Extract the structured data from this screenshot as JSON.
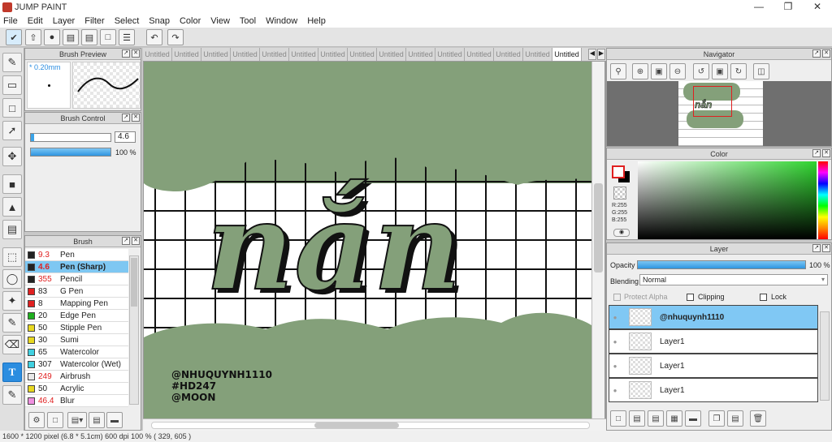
{
  "app": {
    "title": "JUMP PAINT"
  },
  "menu": [
    "File",
    "Edit",
    "Layer",
    "Filter",
    "Select",
    "Snap",
    "Color",
    "View",
    "Tool",
    "Window",
    "Help"
  ],
  "tabs": [
    "Untitled",
    "Untitled",
    "Untitled",
    "Untitled",
    "Untitled",
    "Untitled",
    "Untitled",
    "Untitled",
    "Untitled",
    "Untitled",
    "Untitled",
    "Untitled",
    "Untitled",
    "Untitled",
    "Untitled"
  ],
  "brush_preview": {
    "title": "Brush Preview",
    "size_label": "* 0.20mm"
  },
  "brush_control": {
    "title": "Brush Control",
    "size_value": "4.6",
    "opacity_value": "100 %",
    "size_fraction": 0.03,
    "opacity_fraction": 1.0
  },
  "brush": {
    "title": "Brush",
    "items": [
      {
        "size": "9.3",
        "name": "Pen",
        "color": "#222222",
        "size_red": true
      },
      {
        "size": "4.6",
        "name": "Pen (Sharp)",
        "color": "#222222",
        "size_red": true,
        "selected": true
      },
      {
        "size": "355",
        "name": "Pencil",
        "color": "#222222",
        "size_red": true
      },
      {
        "size": "83",
        "name": "G Pen",
        "color": "#e02020",
        "size_red": false
      },
      {
        "size": "8",
        "name": "Mapping Pen",
        "color": "#e02020",
        "size_red": false
      },
      {
        "size": "20",
        "name": "Edge Pen",
        "color": "#20b020",
        "size_red": false
      },
      {
        "size": "50",
        "name": "Stipple Pen",
        "color": "#e8d820",
        "size_red": false
      },
      {
        "size": "30",
        "name": "Sumi",
        "color": "#e8d820",
        "size_red": false
      },
      {
        "size": "65",
        "name": "Watercolor",
        "color": "#40d0e0",
        "size_red": false
      },
      {
        "size": "307",
        "name": "Watercolor (Wet)",
        "color": "#40d0e0",
        "size_red": false
      },
      {
        "size": "249",
        "name": "Airbrush",
        "color": "#e8e8e8",
        "size_red": true
      },
      {
        "size": "50",
        "name": "Acrylic",
        "color": "#e8d820",
        "size_red": false
      },
      {
        "size": "46.4",
        "name": "Blur",
        "color": "#f090e0",
        "size_red": true
      }
    ]
  },
  "navigator": {
    "title": "Navigator"
  },
  "color": {
    "title": "Color",
    "r": "R:255",
    "g": "G:255",
    "b": "B:255"
  },
  "layer": {
    "title": "Layer",
    "opacity_label": "Opacity",
    "opacity_value": "100 %",
    "opacity_fraction": 1.0,
    "blending_label": "Blending",
    "blending_value": "Normal",
    "protect_alpha": "Protect Alpha",
    "clipping": "Clipping",
    "lock": "Lock",
    "rows": [
      {
        "name": "@nhuquynh1110",
        "selected": true
      },
      {
        "name": "Layer1",
        "selected": false
      },
      {
        "name": "Layer1",
        "selected": false
      },
      {
        "name": "Layer1",
        "selected": false
      }
    ]
  },
  "artwork": {
    "lines": [
      "@NHUQUYNH1110",
      "#HD247",
      "@MOON"
    ],
    "word": "nắn",
    "green": "#84a07a"
  },
  "status": {
    "text": "1600 * 1200 pixel   (6.8 * 5.1cm)   600 dpi   100 %   ( 329, 605 )"
  },
  "icons": {
    "window_buttons": [
      "minimize-icon",
      "maximize-icon",
      "close-icon"
    ]
  }
}
